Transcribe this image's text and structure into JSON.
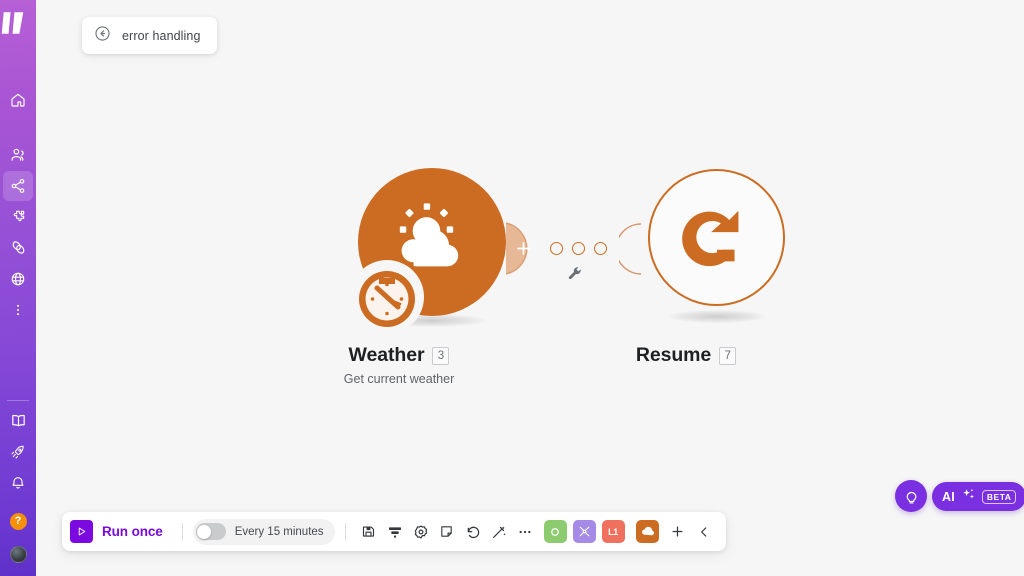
{
  "app": {
    "logo_name": "make-logo",
    "canvas_background": "#f6f6f6",
    "accent_purple": "#7a0ae0",
    "accent_orange": "#cc6c22",
    "sidebar_gradient_from": "#b660d6",
    "sidebar_gradient_to": "#5f31c9"
  },
  "breadcrumb": {
    "back_icon": "arrow-left-circle-icon",
    "label": "error handling"
  },
  "sidebar": {
    "top_items": [
      {
        "icon": "home-icon",
        "name": "home",
        "active": false
      },
      {
        "icon": "team-icon",
        "name": "team",
        "active": false
      },
      {
        "icon": "share-nodes-icon",
        "name": "scenarios",
        "active": true
      },
      {
        "icon": "puzzle-icon",
        "name": "templates",
        "active": false
      },
      {
        "icon": "link-icon",
        "name": "connections",
        "active": false
      },
      {
        "icon": "globe-icon",
        "name": "webhooks",
        "active": false
      },
      {
        "icon": "more-vertical-icon",
        "name": "more",
        "active": false
      }
    ],
    "bottom_items": [
      {
        "icon": "book-icon",
        "name": "docs"
      },
      {
        "icon": "rocket-icon",
        "name": "whats-new"
      },
      {
        "icon": "bell-icon",
        "name": "notifications"
      }
    ],
    "help_label": "?",
    "avatar_name": "user-avatar"
  },
  "canvas": {
    "nodes": [
      {
        "id": "weather",
        "title": "Weather",
        "badge": "3",
        "subtitle": "Get current weather",
        "icon": "sun-cloud-icon",
        "style": "filled",
        "color": "#cc6c22",
        "badge_icon": "clock-schedule-icon"
      },
      {
        "id": "resume",
        "title": "Resume",
        "badge": "7",
        "subtitle": "",
        "icon": "redo-arrow-icon",
        "style": "outlined",
        "color": "#cc6c22"
      }
    ],
    "connector": {
      "add_module_icon": "plus-icon",
      "dot_count": 3,
      "tools_icon": "wrench-icon"
    }
  },
  "ai": {
    "bulb_icon": "lightbulb-icon",
    "label": "AI",
    "sparkle_icon": "sparkles-icon",
    "badge": "BETA"
  },
  "toolbar": {
    "run_icon": "play-icon",
    "run_label": "Run once",
    "schedule_toggle_on": false,
    "schedule_label": "Every 15 minutes",
    "icons": [
      {
        "name": "save-icon",
        "glyph": "save"
      },
      {
        "name": "align-icon",
        "glyph": "align"
      },
      {
        "name": "settings-gear-icon",
        "glyph": "gear"
      },
      {
        "name": "note-icon",
        "glyph": "note"
      },
      {
        "name": "undo-icon",
        "glyph": "undo"
      },
      {
        "name": "magic-wand-icon",
        "glyph": "wand"
      },
      {
        "name": "more-horizontal-icon",
        "glyph": "ellipsis"
      }
    ],
    "color_buttons": [
      {
        "name": "module-green-button",
        "color": "#8ccb6e",
        "glyph": "circle-dot",
        "label": ""
      },
      {
        "name": "module-purple-button",
        "color": "#a58ae8",
        "glyph": "tools",
        "label": ""
      },
      {
        "name": "module-red-button",
        "color": "#f0705e",
        "glyph": "text",
        "label": "L1"
      },
      {
        "name": "module-orange-button",
        "color": "#cc6c22",
        "glyph": "cloud",
        "label": ""
      }
    ],
    "add_label": "+",
    "collapse_icon": "chevron-left-icon"
  }
}
